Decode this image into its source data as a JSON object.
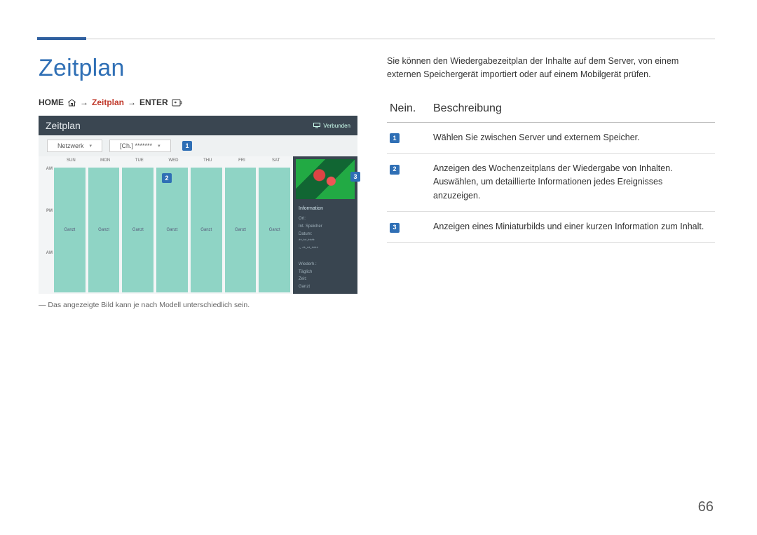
{
  "page_number": "66",
  "title": "Zeitplan",
  "nav": {
    "home": "HOME",
    "mid": "Zeitplan",
    "enter": "ENTER"
  },
  "mock": {
    "title": "Zeitplan",
    "connected": "Verbunden",
    "btn_network": "Netzwerk",
    "btn_ch": "[Ch.] *******",
    "days": [
      "SUN",
      "MON",
      "TUE",
      "WED",
      "THU",
      "FRI",
      "SAT"
    ],
    "hours": [
      "AM",
      "PM",
      "AM"
    ],
    "cell_label": "Ganzt",
    "info_title": "Information",
    "info_lines": [
      "Ort:",
      "Int. Speicher",
      "Datum:",
      "**-**-****",
      "~ **-**-****",
      "",
      "Wiederh.:",
      "Täglich",
      "Zeit:",
      "Ganzt"
    ]
  },
  "callouts": {
    "c1": "1",
    "c2": "2",
    "c3": "3"
  },
  "footnote": "Das angezeigte Bild kann je nach Modell unterschiedlich sein.",
  "intro": "Sie können den Wiedergabezeitplan der Inhalte auf dem Server, von einem externen Speichergerät importiert oder auf einem Mobilgerät prüfen.",
  "table": {
    "head_no": "Nein.",
    "head_desc": "Beschreibung",
    "rows": [
      {
        "n": "1",
        "d": "Wählen Sie zwischen Server und externem Speicher."
      },
      {
        "n": "2",
        "d": "Anzeigen des Wochenzeitplans der Wiedergabe von Inhalten.\nAuswählen, um detaillierte Informationen jedes Ereignisses anzuzeigen."
      },
      {
        "n": "3",
        "d": "Anzeigen eines Miniaturbilds und einer kurzen Information zum Inhalt."
      }
    ]
  }
}
